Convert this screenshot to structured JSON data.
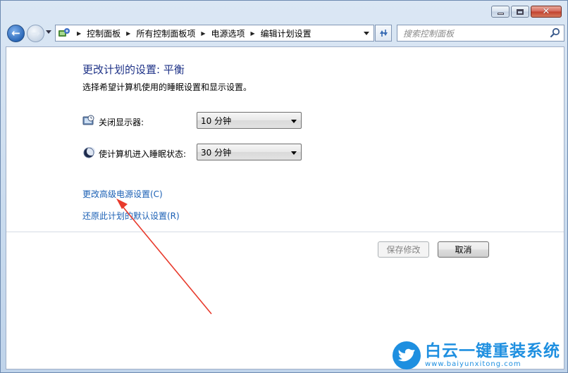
{
  "window": {
    "controls": {
      "minimize_icon": "minimize-icon",
      "maximize_icon": "maximize-icon",
      "close_glyph": "✕"
    }
  },
  "nav": {
    "back_glyph": "←",
    "forward_glyph": "→",
    "breadcrumbs": [
      "控制面板",
      "所有控制面板项",
      "电源选项",
      "编辑计划设置"
    ],
    "search_placeholder": "搜索控制面板"
  },
  "main": {
    "title": "更改计划的设置: 平衡",
    "subtitle": "选择希望计算机使用的睡眠设置和显示设置。",
    "settings": [
      {
        "label": "关闭显示器:",
        "value": "10 分钟",
        "icon": "monitor-clock-icon"
      },
      {
        "label": "使计算机进入睡眠状态:",
        "value": "30 分钟",
        "icon": "moon-sleep-icon"
      }
    ],
    "links": {
      "advanced": "更改高级电源设置(C)",
      "restore": "还原此计划的默认设置(R)"
    },
    "buttons": {
      "save": "保存修改",
      "cancel": "取消"
    }
  },
  "annotation": {
    "color": "#e83a2c"
  },
  "watermark": {
    "title": "白云一键重装系统",
    "url": "www.baiyunxitong.com",
    "color": "#1e8fe0"
  }
}
